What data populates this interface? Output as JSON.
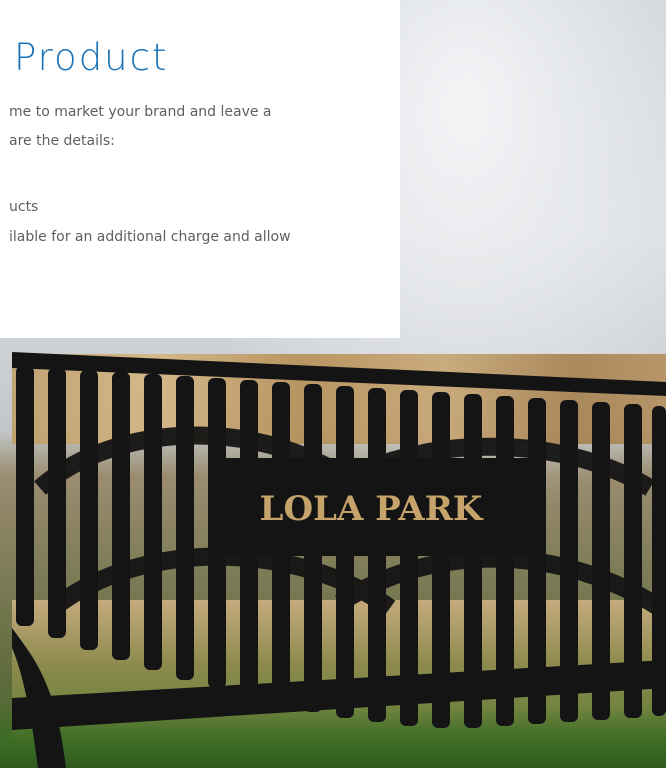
{
  "content": {
    "title": "Product",
    "paragraph_line_1": "me to market your brand and leave a",
    "paragraph_line_2": "are the details:",
    "bullet_line_1": "ucts",
    "bullet_line_2": "ilable for an additional charge and allow"
  },
  "photo": {
    "sign_text": "LOLA PARK"
  },
  "colors": {
    "title_blue": "#1b73b7",
    "body_text": "#5f5f5f",
    "bench_black": "#141414"
  }
}
